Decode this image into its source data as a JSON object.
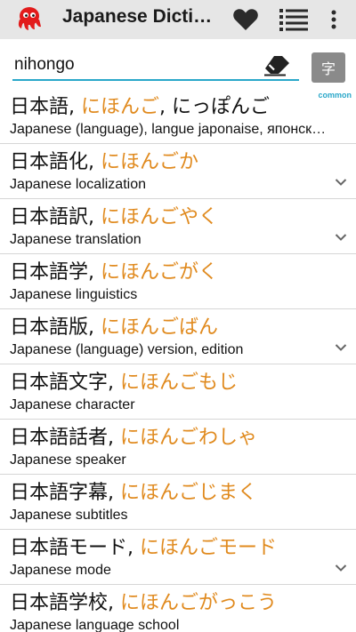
{
  "toolbar": {
    "title": "Japanese Dictionary",
    "icons": {
      "logo": "octopus-logo-icon",
      "favorites": "heart-icon",
      "list": "list-icon",
      "more": "more-vert-icon"
    },
    "colors": {
      "background": "#e6e6e6",
      "logo": "#e21b1b"
    }
  },
  "search": {
    "value": "nihongo",
    "placeholder": "",
    "clear_icon": "eraser-icon",
    "kanji_button_label": "字",
    "colors": {
      "underline": "#2aa7c9"
    }
  },
  "colors": {
    "reading": "#e08a1e",
    "tag": "#2aa7c9"
  },
  "results": [
    {
      "kanji": "日本語",
      "reading": "にほんご",
      "alt_reading": "にっぽんご",
      "gloss": "Japanese (language), langue japonaise, японский язык",
      "tag": "common",
      "expandable": false
    },
    {
      "kanji": "日本語化",
      "reading": "にほんごか",
      "gloss": "Japanese localization",
      "expandable": true
    },
    {
      "kanji": "日本語訳",
      "reading": "にほんごやく",
      "gloss": "Japanese translation",
      "expandable": true
    },
    {
      "kanji": "日本語学",
      "reading": "にほんごがく",
      "gloss": "Japanese linguistics",
      "expandable": false
    },
    {
      "kanji": "日本語版",
      "reading": "にほんごばん",
      "gloss": "Japanese (language) version, edition",
      "expandable": true
    },
    {
      "kanji": "日本語文字",
      "reading": "にほんごもじ",
      "gloss": "Japanese character",
      "expandable": false
    },
    {
      "kanji": "日本語話者",
      "reading": "にほんごわしゃ",
      "gloss": "Japanese speaker",
      "expandable": false
    },
    {
      "kanji": "日本語字幕",
      "reading": "にほんごじまく",
      "gloss": "Japanese subtitles",
      "expandable": false
    },
    {
      "kanji": "日本語モード",
      "reading": "にほんごモード",
      "gloss": "Japanese mode",
      "expandable": true
    },
    {
      "kanji": "日本語学校",
      "reading": "にほんごがっこう",
      "gloss": "Japanese language school",
      "expandable": false
    }
  ]
}
